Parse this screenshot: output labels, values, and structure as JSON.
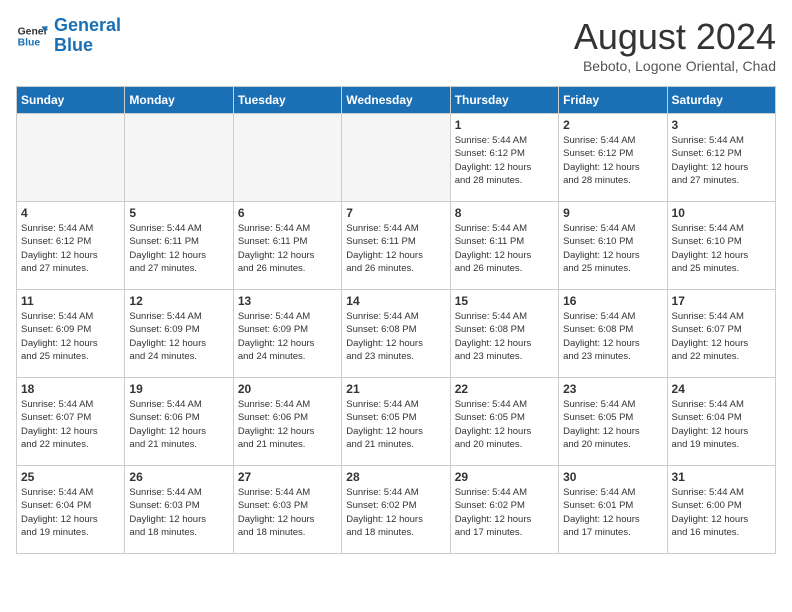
{
  "header": {
    "logo_line1": "General",
    "logo_line2": "Blue",
    "title": "August 2024",
    "subtitle": "Beboto, Logone Oriental, Chad"
  },
  "weekdays": [
    "Sunday",
    "Monday",
    "Tuesday",
    "Wednesday",
    "Thursday",
    "Friday",
    "Saturday"
  ],
  "weeks": [
    [
      {
        "day": "",
        "info": ""
      },
      {
        "day": "",
        "info": ""
      },
      {
        "day": "",
        "info": ""
      },
      {
        "day": "",
        "info": ""
      },
      {
        "day": "1",
        "info": "Sunrise: 5:44 AM\nSunset: 6:12 PM\nDaylight: 12 hours\nand 28 minutes."
      },
      {
        "day": "2",
        "info": "Sunrise: 5:44 AM\nSunset: 6:12 PM\nDaylight: 12 hours\nand 28 minutes."
      },
      {
        "day": "3",
        "info": "Sunrise: 5:44 AM\nSunset: 6:12 PM\nDaylight: 12 hours\nand 27 minutes."
      }
    ],
    [
      {
        "day": "4",
        "info": "Sunrise: 5:44 AM\nSunset: 6:12 PM\nDaylight: 12 hours\nand 27 minutes."
      },
      {
        "day": "5",
        "info": "Sunrise: 5:44 AM\nSunset: 6:11 PM\nDaylight: 12 hours\nand 27 minutes."
      },
      {
        "day": "6",
        "info": "Sunrise: 5:44 AM\nSunset: 6:11 PM\nDaylight: 12 hours\nand 26 minutes."
      },
      {
        "day": "7",
        "info": "Sunrise: 5:44 AM\nSunset: 6:11 PM\nDaylight: 12 hours\nand 26 minutes."
      },
      {
        "day": "8",
        "info": "Sunrise: 5:44 AM\nSunset: 6:11 PM\nDaylight: 12 hours\nand 26 minutes."
      },
      {
        "day": "9",
        "info": "Sunrise: 5:44 AM\nSunset: 6:10 PM\nDaylight: 12 hours\nand 25 minutes."
      },
      {
        "day": "10",
        "info": "Sunrise: 5:44 AM\nSunset: 6:10 PM\nDaylight: 12 hours\nand 25 minutes."
      }
    ],
    [
      {
        "day": "11",
        "info": "Sunrise: 5:44 AM\nSunset: 6:09 PM\nDaylight: 12 hours\nand 25 minutes."
      },
      {
        "day": "12",
        "info": "Sunrise: 5:44 AM\nSunset: 6:09 PM\nDaylight: 12 hours\nand 24 minutes."
      },
      {
        "day": "13",
        "info": "Sunrise: 5:44 AM\nSunset: 6:09 PM\nDaylight: 12 hours\nand 24 minutes."
      },
      {
        "day": "14",
        "info": "Sunrise: 5:44 AM\nSunset: 6:08 PM\nDaylight: 12 hours\nand 23 minutes."
      },
      {
        "day": "15",
        "info": "Sunrise: 5:44 AM\nSunset: 6:08 PM\nDaylight: 12 hours\nand 23 minutes."
      },
      {
        "day": "16",
        "info": "Sunrise: 5:44 AM\nSunset: 6:08 PM\nDaylight: 12 hours\nand 23 minutes."
      },
      {
        "day": "17",
        "info": "Sunrise: 5:44 AM\nSunset: 6:07 PM\nDaylight: 12 hours\nand 22 minutes."
      }
    ],
    [
      {
        "day": "18",
        "info": "Sunrise: 5:44 AM\nSunset: 6:07 PM\nDaylight: 12 hours\nand 22 minutes."
      },
      {
        "day": "19",
        "info": "Sunrise: 5:44 AM\nSunset: 6:06 PM\nDaylight: 12 hours\nand 21 minutes."
      },
      {
        "day": "20",
        "info": "Sunrise: 5:44 AM\nSunset: 6:06 PM\nDaylight: 12 hours\nand 21 minutes."
      },
      {
        "day": "21",
        "info": "Sunrise: 5:44 AM\nSunset: 6:05 PM\nDaylight: 12 hours\nand 21 minutes."
      },
      {
        "day": "22",
        "info": "Sunrise: 5:44 AM\nSunset: 6:05 PM\nDaylight: 12 hours\nand 20 minutes."
      },
      {
        "day": "23",
        "info": "Sunrise: 5:44 AM\nSunset: 6:05 PM\nDaylight: 12 hours\nand 20 minutes."
      },
      {
        "day": "24",
        "info": "Sunrise: 5:44 AM\nSunset: 6:04 PM\nDaylight: 12 hours\nand 19 minutes."
      }
    ],
    [
      {
        "day": "25",
        "info": "Sunrise: 5:44 AM\nSunset: 6:04 PM\nDaylight: 12 hours\nand 19 minutes."
      },
      {
        "day": "26",
        "info": "Sunrise: 5:44 AM\nSunset: 6:03 PM\nDaylight: 12 hours\nand 18 minutes."
      },
      {
        "day": "27",
        "info": "Sunrise: 5:44 AM\nSunset: 6:03 PM\nDaylight: 12 hours\nand 18 minutes."
      },
      {
        "day": "28",
        "info": "Sunrise: 5:44 AM\nSunset: 6:02 PM\nDaylight: 12 hours\nand 18 minutes."
      },
      {
        "day": "29",
        "info": "Sunrise: 5:44 AM\nSunset: 6:02 PM\nDaylight: 12 hours\nand 17 minutes."
      },
      {
        "day": "30",
        "info": "Sunrise: 5:44 AM\nSunset: 6:01 PM\nDaylight: 12 hours\nand 17 minutes."
      },
      {
        "day": "31",
        "info": "Sunrise: 5:44 AM\nSunset: 6:00 PM\nDaylight: 12 hours\nand 16 minutes."
      }
    ]
  ]
}
